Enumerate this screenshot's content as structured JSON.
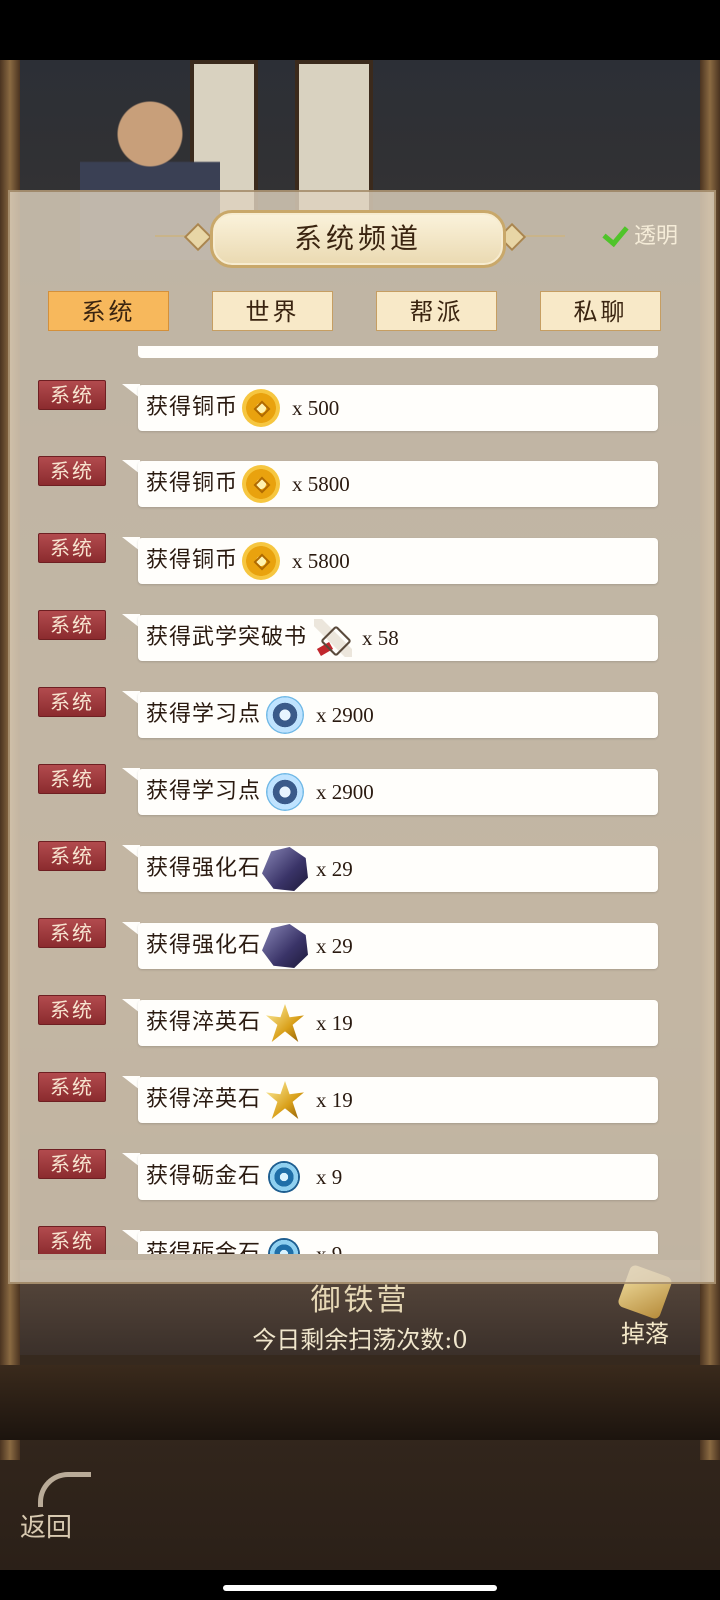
{
  "panel": {
    "title": "系统频道",
    "transparent_label": "透明"
  },
  "tabs": [
    {
      "label": "系统",
      "active": true
    },
    {
      "label": "世界",
      "active": false
    },
    {
      "label": "帮派",
      "active": false
    },
    {
      "label": "私聊",
      "active": false
    }
  ],
  "messages": [
    {
      "tag": "系统",
      "text": "获得铜币",
      "icon": "copper-coin-icon",
      "qty": "x 500"
    },
    {
      "tag": "系统",
      "text": "获得铜币",
      "icon": "copper-coin-icon",
      "qty": "x 5800"
    },
    {
      "tag": "系统",
      "text": "获得铜币",
      "icon": "copper-coin-icon",
      "qty": "x 5800"
    },
    {
      "tag": "系统",
      "text": "获得武学突破书",
      "icon": "martial-breakthrough-book-icon",
      "qty": "x 58"
    },
    {
      "tag": "系统",
      "text": "获得学习点",
      "icon": "study-point-icon",
      "qty": "x 2900"
    },
    {
      "tag": "系统",
      "text": "获得学习点",
      "icon": "study-point-icon",
      "qty": "x 2900"
    },
    {
      "tag": "系统",
      "text": "获得强化石",
      "icon": "enhance-stone-icon",
      "qty": "x 29"
    },
    {
      "tag": "系统",
      "text": "获得强化石",
      "icon": "enhance-stone-icon",
      "qty": "x 29"
    },
    {
      "tag": "系统",
      "text": "获得淬英石",
      "icon": "temper-stone-icon",
      "qty": "x 19"
    },
    {
      "tag": "系统",
      "text": "获得淬英石",
      "icon": "temper-stone-icon",
      "qty": "x 19"
    },
    {
      "tag": "系统",
      "text": "获得砺金石",
      "icon": "whetstone-gold-icon",
      "qty": "x 9"
    },
    {
      "tag": "系统",
      "text": "获得砺金石",
      "icon": "whetstone-gold-icon",
      "qty": "x 9"
    }
  ],
  "bottom": {
    "location_name": "御铁营",
    "sweep_remaining": "今日剩余扫荡次数:0",
    "drop_label": "掉落",
    "back_label": "返回"
  }
}
